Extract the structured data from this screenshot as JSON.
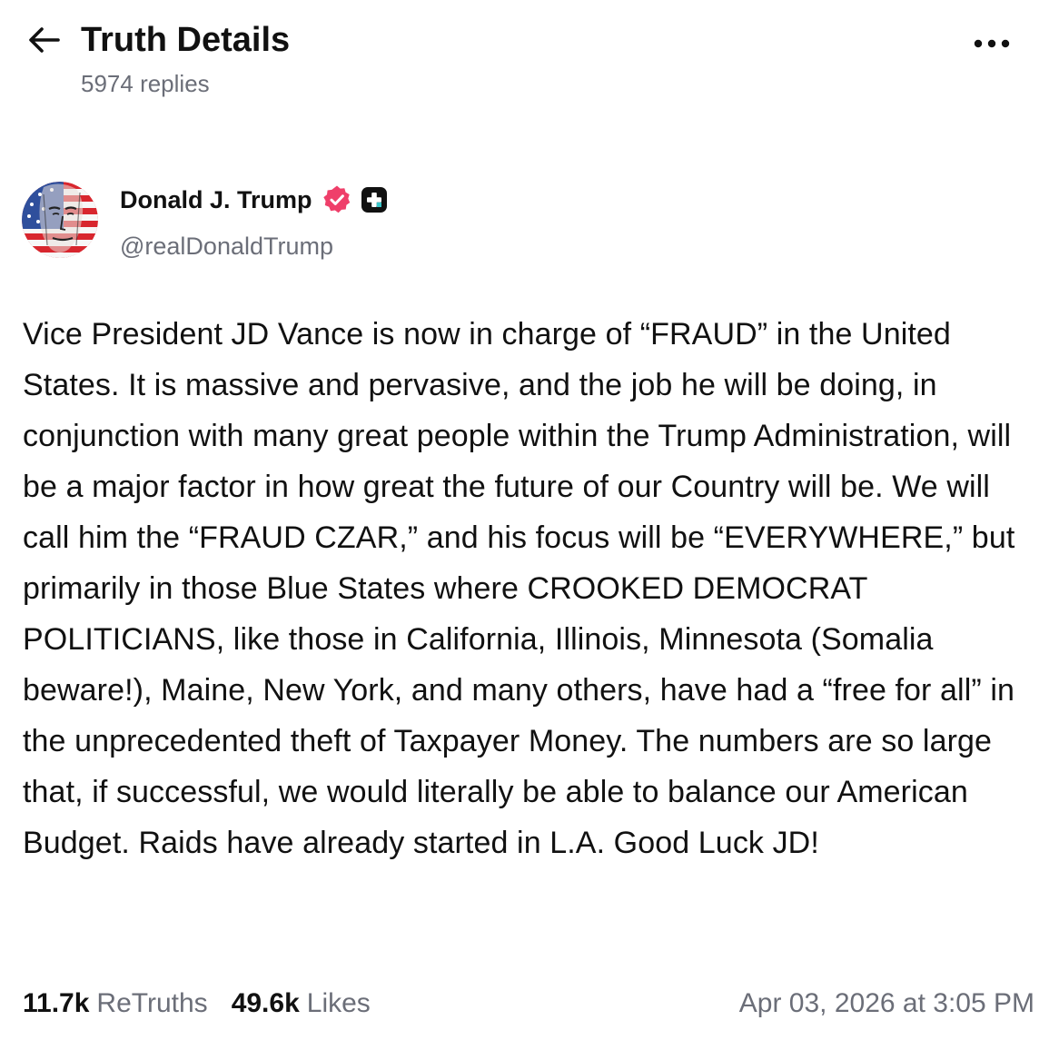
{
  "header": {
    "title": "Truth Details",
    "replies": "5974 replies",
    "back_icon": "arrow-left-icon",
    "more_icon": "more-horizontal-icon"
  },
  "author": {
    "display_name": "Donald J. Trump",
    "handle": "@realDonaldTrump",
    "verified_icon": "verified-badge-icon",
    "verified_color": "#ef3f6a",
    "plus_badge_icon": "plus-badge-icon",
    "avatar_icon": "avatar-flag-portrait"
  },
  "post": {
    "text": "Vice President JD Vance is now in charge of “FRAUD” in the United States. It is massive and pervasive, and the job he will be doing, in conjunction with many great people within the Trump Administration, will be a major factor in how great the future of our Country will be. We will call him the “FRAUD CZAR,” and his focus will be “EVERYWHERE,” but primarily in those Blue States where CROOKED DEMOCRAT POLITICIANS, like those in California, Illinois, Minnesota (Somalia beware!), Maine, New York, and many others, have had a “free for all” in the unprecedented theft of Taxpayer Money. The numbers are so large that, if successful, we would literally be able to balance our American Budget. Raids have already started in L.A. Good Luck JD!"
  },
  "stats": {
    "retruths_count": "11.7k",
    "retruths_label": "ReTruths",
    "likes_count": "49.6k",
    "likes_label": "Likes",
    "timestamp": "Apr 03, 2026 at 3:05 PM"
  },
  "colors": {
    "text_primary": "#111111",
    "text_secondary": "#6b6e78",
    "background": "#ffffff"
  }
}
